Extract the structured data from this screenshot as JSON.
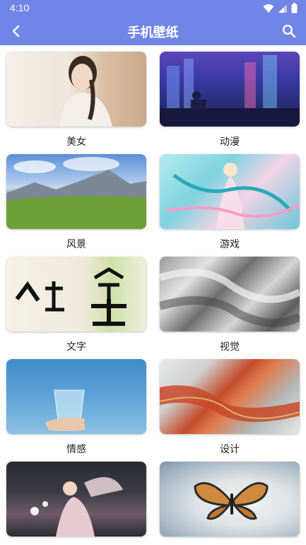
{
  "status_bar": {
    "time": "4:10"
  },
  "app_bar": {
    "title": "手机壁纸"
  },
  "categories": [
    {
      "label": "美女",
      "image": "woman-portrait-image"
    },
    {
      "label": "动漫",
      "image": "anime-city-image"
    },
    {
      "label": "风景",
      "image": "landscape-image"
    },
    {
      "label": "游戏",
      "image": "game-art-image"
    },
    {
      "label": "文字",
      "image": "calligraphy-image"
    },
    {
      "label": "视觉",
      "image": "abstract-silver-image"
    },
    {
      "label": "情感",
      "image": "hand-glass-image"
    },
    {
      "label": "设计",
      "image": "marble-art-image"
    },
    {
      "label": "",
      "image": "fairy-girl-image"
    },
    {
      "label": "",
      "image": "butterfly-image"
    }
  ]
}
